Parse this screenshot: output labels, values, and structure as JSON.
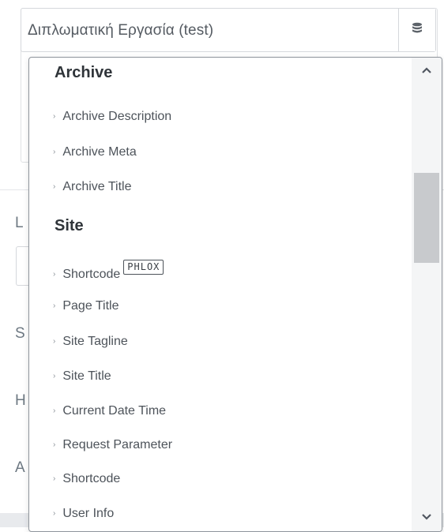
{
  "title_field": {
    "value": "Διπλωματική Εργασία (test)",
    "button_icon": "database-icon"
  },
  "background": {
    "partial_labels": [
      "L",
      "S",
      "H",
      "A"
    ]
  },
  "dropdown": {
    "groups": [
      {
        "title": "Archive",
        "items": [
          {
            "label": "Archive Description"
          },
          {
            "label": "Archive Meta"
          },
          {
            "label": "Archive Title"
          }
        ]
      },
      {
        "title": "Site",
        "items": [
          {
            "label": "Shortcode",
            "badge": "PHLOX"
          },
          {
            "label": "Page Title"
          },
          {
            "label": "Site Tagline"
          },
          {
            "label": "Site Title"
          },
          {
            "label": "Current Date Time"
          },
          {
            "label": "Request Parameter"
          },
          {
            "label": "Shortcode"
          },
          {
            "label": "User Info"
          }
        ]
      }
    ],
    "item_marker": "›",
    "scrollbar": {
      "up_icon": "chevron-up-icon",
      "down_icon": "chevron-down-icon"
    }
  },
  "colors": {
    "border": "#d5d8dc",
    "dropdown_border": "#8f959c",
    "scroll_thumb": "#c8cacd",
    "text": "#4d535a",
    "group_title": "#2f3439"
  }
}
